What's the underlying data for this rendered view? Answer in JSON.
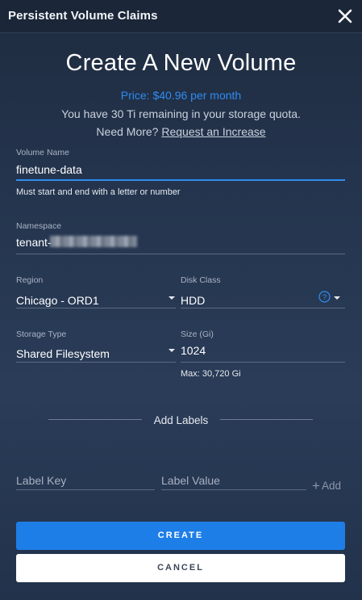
{
  "window": {
    "title": "Persistent Volume Claims"
  },
  "header": {
    "heading": "Create A New Volume",
    "price": "Price: $40.96 per month",
    "quota": "You have 30 Ti remaining in your storage quota.",
    "need_more": "Need More?",
    "request_link": "Request an Increase"
  },
  "form": {
    "volume_name": {
      "label": "Volume Name",
      "value": "finetune-data",
      "helper": "Must start and end with a letter or number"
    },
    "namespace": {
      "label": "Namespace",
      "value": "tenant-"
    },
    "region": {
      "label": "Region",
      "value": "Chicago - ORD1"
    },
    "disk_class": {
      "label": "Disk Class",
      "value": "HDD"
    },
    "storage_type": {
      "label": "Storage Type",
      "value": "Shared Filesystem"
    },
    "size": {
      "label": "Size (Gi)",
      "value": "1024",
      "helper": "Max: 30,720 Gi"
    }
  },
  "labels": {
    "title": "Add Labels",
    "key_placeholder": "Label Key",
    "value_placeholder": "Label Value",
    "add_label": "Add"
  },
  "actions": {
    "create": "CREATE",
    "cancel": "CANCEL"
  },
  "colors": {
    "accent": "#1e7ee8",
    "price": "#2f8cf0",
    "dialog_bg": "#24344d"
  },
  "icons": {
    "close": "close-icon",
    "help": "help-circle-icon",
    "caret": "caret-down-icon",
    "add": "plus-icon"
  }
}
